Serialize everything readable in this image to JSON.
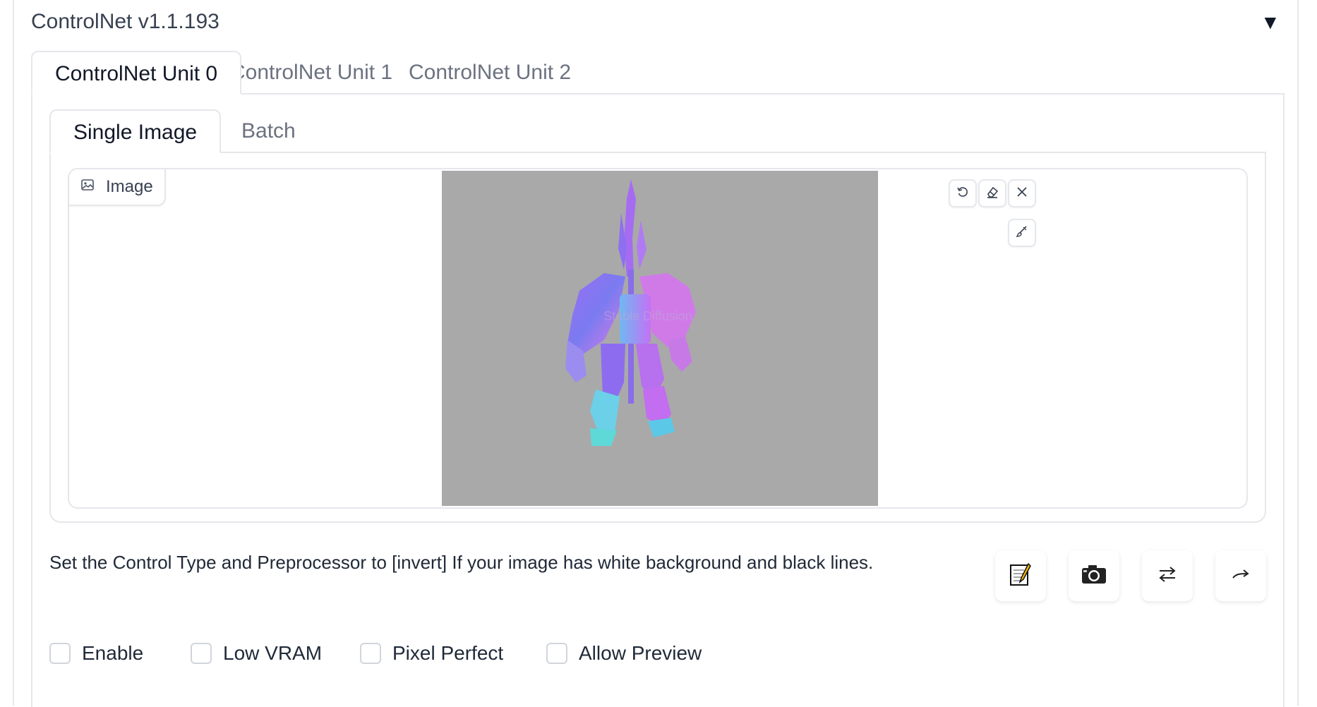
{
  "panel": {
    "title": "ControlNet v1.1.193",
    "collapse_icon": "triangle-down-icon"
  },
  "unit_tabs": [
    "ControlNet Unit 0",
    "ControlNet Unit 1",
    "ControlNet Unit 2"
  ],
  "mode_tabs": [
    "Single Image",
    "Batch"
  ],
  "image_input": {
    "label": "Image",
    "icon": "image-icon",
    "watermark": "Stable Diffusion"
  },
  "image_tools": [
    "undo-icon",
    "eraser-icon",
    "close-icon",
    "brush-icon"
  ],
  "hint": "Set the Control Type and Preprocessor to [invert] If your image has white background and black lines.",
  "action_buttons": [
    "notepad-icon",
    "camera-icon",
    "swap-icon",
    "send-dimensions-icon"
  ],
  "checkboxes": [
    {
      "label": "Enable",
      "checked": false
    },
    {
      "label": "Low VRAM",
      "checked": false
    },
    {
      "label": "Pixel Perfect",
      "checked": false
    },
    {
      "label": "Allow Preview",
      "checked": false
    }
  ],
  "colors": {
    "accent": "#8b5cf6",
    "canvas_bg": "#a9a9a9",
    "border": "#e5e7eb"
  }
}
